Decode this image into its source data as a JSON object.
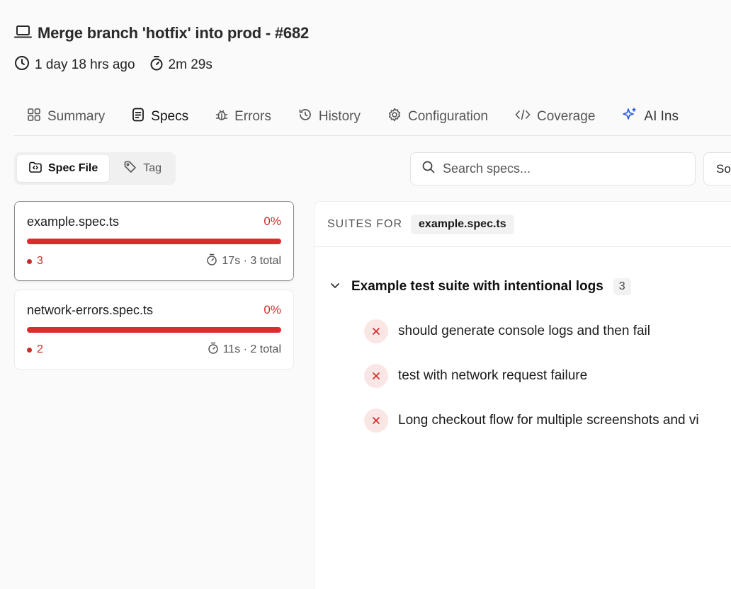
{
  "header": {
    "title": "Merge branch 'hotfix' into prod - #682",
    "time_ago": "1 day 18 hrs ago",
    "duration": "2m 29s"
  },
  "tabs": [
    {
      "label": "Summary",
      "icon": "grid-icon",
      "active": false
    },
    {
      "label": "Specs",
      "icon": "document-icon",
      "active": true
    },
    {
      "label": "Errors",
      "icon": "bug-icon",
      "active": false
    },
    {
      "label": "History",
      "icon": "history-icon",
      "active": false
    },
    {
      "label": "Configuration",
      "icon": "gear-icon",
      "active": false
    },
    {
      "label": "Coverage",
      "icon": "code-icon",
      "active": false
    },
    {
      "label": "AI Ins",
      "icon": "sparkle-icon",
      "active": false
    }
  ],
  "view_toggle": {
    "spec_file": "Spec File",
    "tag": "Tag"
  },
  "search": {
    "placeholder": "Search specs..."
  },
  "sort": {
    "label": "So"
  },
  "spec_files": [
    {
      "name": "example.spec.ts",
      "pass_rate": "0%",
      "pass_fraction": 0,
      "failed": "3",
      "stats": "17s · 3 total",
      "selected": true
    },
    {
      "name": "network-errors.spec.ts",
      "pass_rate": "0%",
      "pass_fraction": 0,
      "failed": "2",
      "stats": "11s · 2 total",
      "selected": false
    }
  ],
  "suites_panel": {
    "label": "SUITES FOR",
    "file": "example.spec.ts",
    "suite": {
      "title": "Example test suite with intentional logs",
      "count": "3",
      "tests": [
        {
          "title": "should generate console logs and then fail",
          "status": "failed"
        },
        {
          "title": "test with network request failure",
          "status": "failed"
        },
        {
          "title": "Long checkout flow for multiple screenshots and vi",
          "status": "failed"
        }
      ]
    }
  },
  "colors": {
    "fail": "#d12a2a",
    "fail_bg": "#fbe6e6",
    "ai_accent": "#2f5fe0"
  }
}
